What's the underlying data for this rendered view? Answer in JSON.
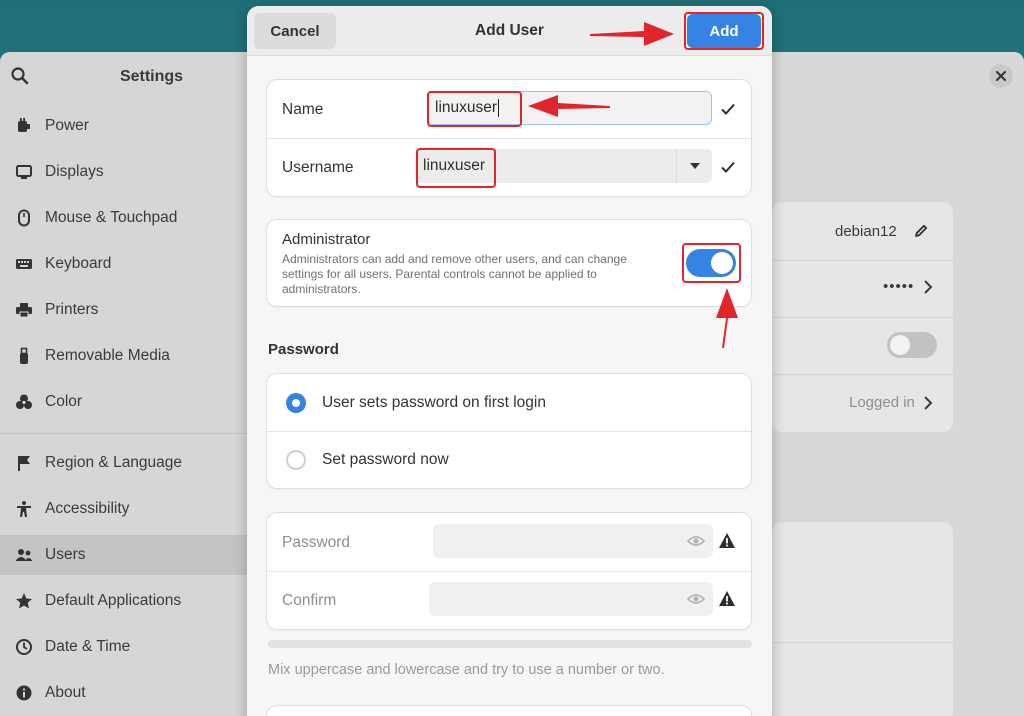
{
  "settings": {
    "title": "Settings",
    "sidebar": [
      {
        "label": "Power",
        "icon": "power-icon"
      },
      {
        "label": "Displays",
        "icon": "display-icon"
      },
      {
        "label": "Mouse & Touchpad",
        "icon": "mouse-icon"
      },
      {
        "label": "Keyboard",
        "icon": "keyboard-icon"
      },
      {
        "label": "Printers",
        "icon": "printer-icon"
      },
      {
        "label": "Removable Media",
        "icon": "usb-icon"
      },
      {
        "label": "Color",
        "icon": "color-icon"
      },
      {
        "label": "Region & Language",
        "icon": "flag-icon"
      },
      {
        "label": "Accessibility",
        "icon": "accessibility-icon"
      },
      {
        "label": "Users",
        "icon": "users-icon",
        "active": true
      },
      {
        "label": "Default Applications",
        "icon": "star-icon"
      },
      {
        "label": "Date & Time",
        "icon": "clock-icon"
      },
      {
        "label": "About",
        "icon": "info-icon"
      }
    ],
    "content": {
      "username": "debian12",
      "password_mask": "•••••",
      "last_login": "Logged in"
    }
  },
  "dialog": {
    "title": "Add User",
    "cancel_label": "Cancel",
    "add_label": "Add",
    "name_label": "Name",
    "name_value": "linuxuser",
    "username_label": "Username",
    "username_value": "linuxuser",
    "admin_title": "Administrator",
    "admin_desc_line1": "Administrators can add and remove other users, and can change",
    "admin_desc_line2": "settings for all users. Parental controls cannot be applied to",
    "admin_desc_line3": "administrators.",
    "admin_enabled": true,
    "password_section": "Password",
    "option_first_login": "User sets password on first login",
    "option_set_now": "Set password now",
    "password_label": "Password",
    "confirm_label": "Confirm",
    "hint": "Mix uppercase and lowercase and try to use a number or two."
  },
  "colors": {
    "accent": "#3584e4",
    "annotation": "#e0262b"
  }
}
